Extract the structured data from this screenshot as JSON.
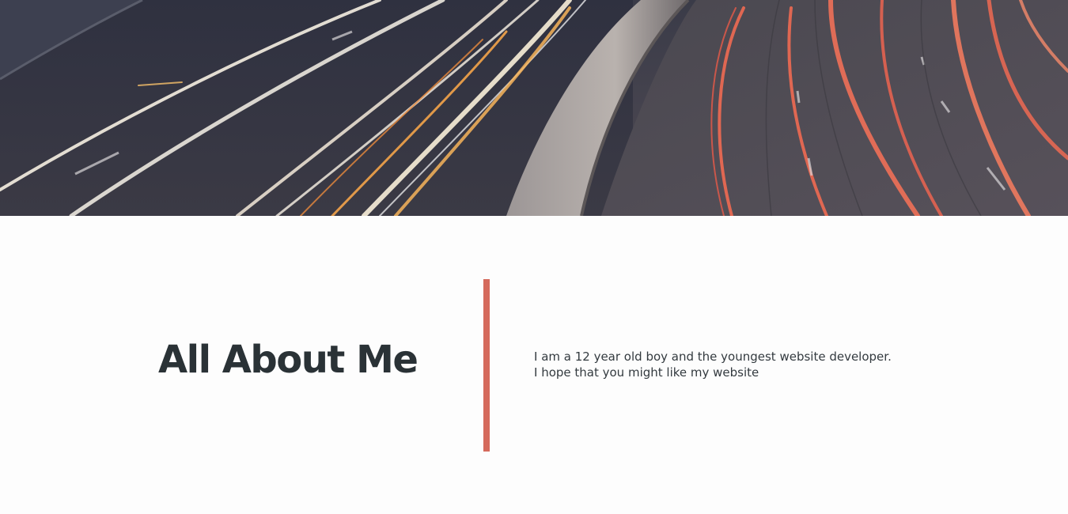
{
  "hero": {
    "image_icon": "highway-light-trails-photo",
    "colors": {
      "asphalt": "#44424c",
      "barrier": "#a9a3a1",
      "trail_white": "#f6efe2",
      "trail_orange": "#f4a44a",
      "trail_red": "#ef6a52"
    }
  },
  "about": {
    "title": "All About Me",
    "text": "I am a 12 year old boy and the youngest website developer. I hope that you might like my website",
    "accent_color": "#d56a5c"
  }
}
